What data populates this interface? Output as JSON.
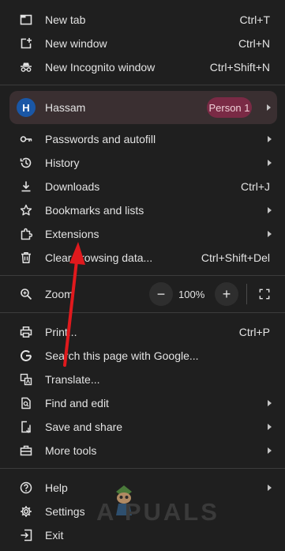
{
  "menu": {
    "new_tab": {
      "label": "New tab",
      "shortcut": "Ctrl+T"
    },
    "new_window": {
      "label": "New window",
      "shortcut": "Ctrl+N"
    },
    "new_incognito": {
      "label": "New Incognito window",
      "shortcut": "Ctrl+Shift+N"
    },
    "profile": {
      "initial": "H",
      "name": "Hassam",
      "badge": "Person 1"
    },
    "passwords": {
      "label": "Passwords and autofill"
    },
    "history": {
      "label": "History"
    },
    "downloads": {
      "label": "Downloads",
      "shortcut": "Ctrl+J"
    },
    "bookmarks": {
      "label": "Bookmarks and lists"
    },
    "extensions": {
      "label": "Extensions"
    },
    "clear_data": {
      "label": "Clear browsing data...",
      "shortcut": "Ctrl+Shift+Del"
    },
    "zoom": {
      "label": "Zoom",
      "value": "100%",
      "minus": "−",
      "plus": "+"
    },
    "print": {
      "label": "Print...",
      "shortcut": "Ctrl+P"
    },
    "search_google": {
      "label": "Search this page with Google..."
    },
    "translate": {
      "label": "Translate..."
    },
    "find_edit": {
      "label": "Find and edit"
    },
    "save_share": {
      "label": "Save and share"
    },
    "more_tools": {
      "label": "More tools"
    },
    "help": {
      "label": "Help"
    },
    "settings": {
      "label": "Settings"
    },
    "exit": {
      "label": "Exit"
    }
  },
  "watermark": {
    "text": "A PUALS"
  },
  "annotation": {
    "color": "#e0191d"
  },
  "colors": {
    "background": "#1f1f1f",
    "profile_bg": "#3a2f31",
    "badge_bg": "#7a2a45",
    "avatar_bg": "#1a57a6"
  }
}
